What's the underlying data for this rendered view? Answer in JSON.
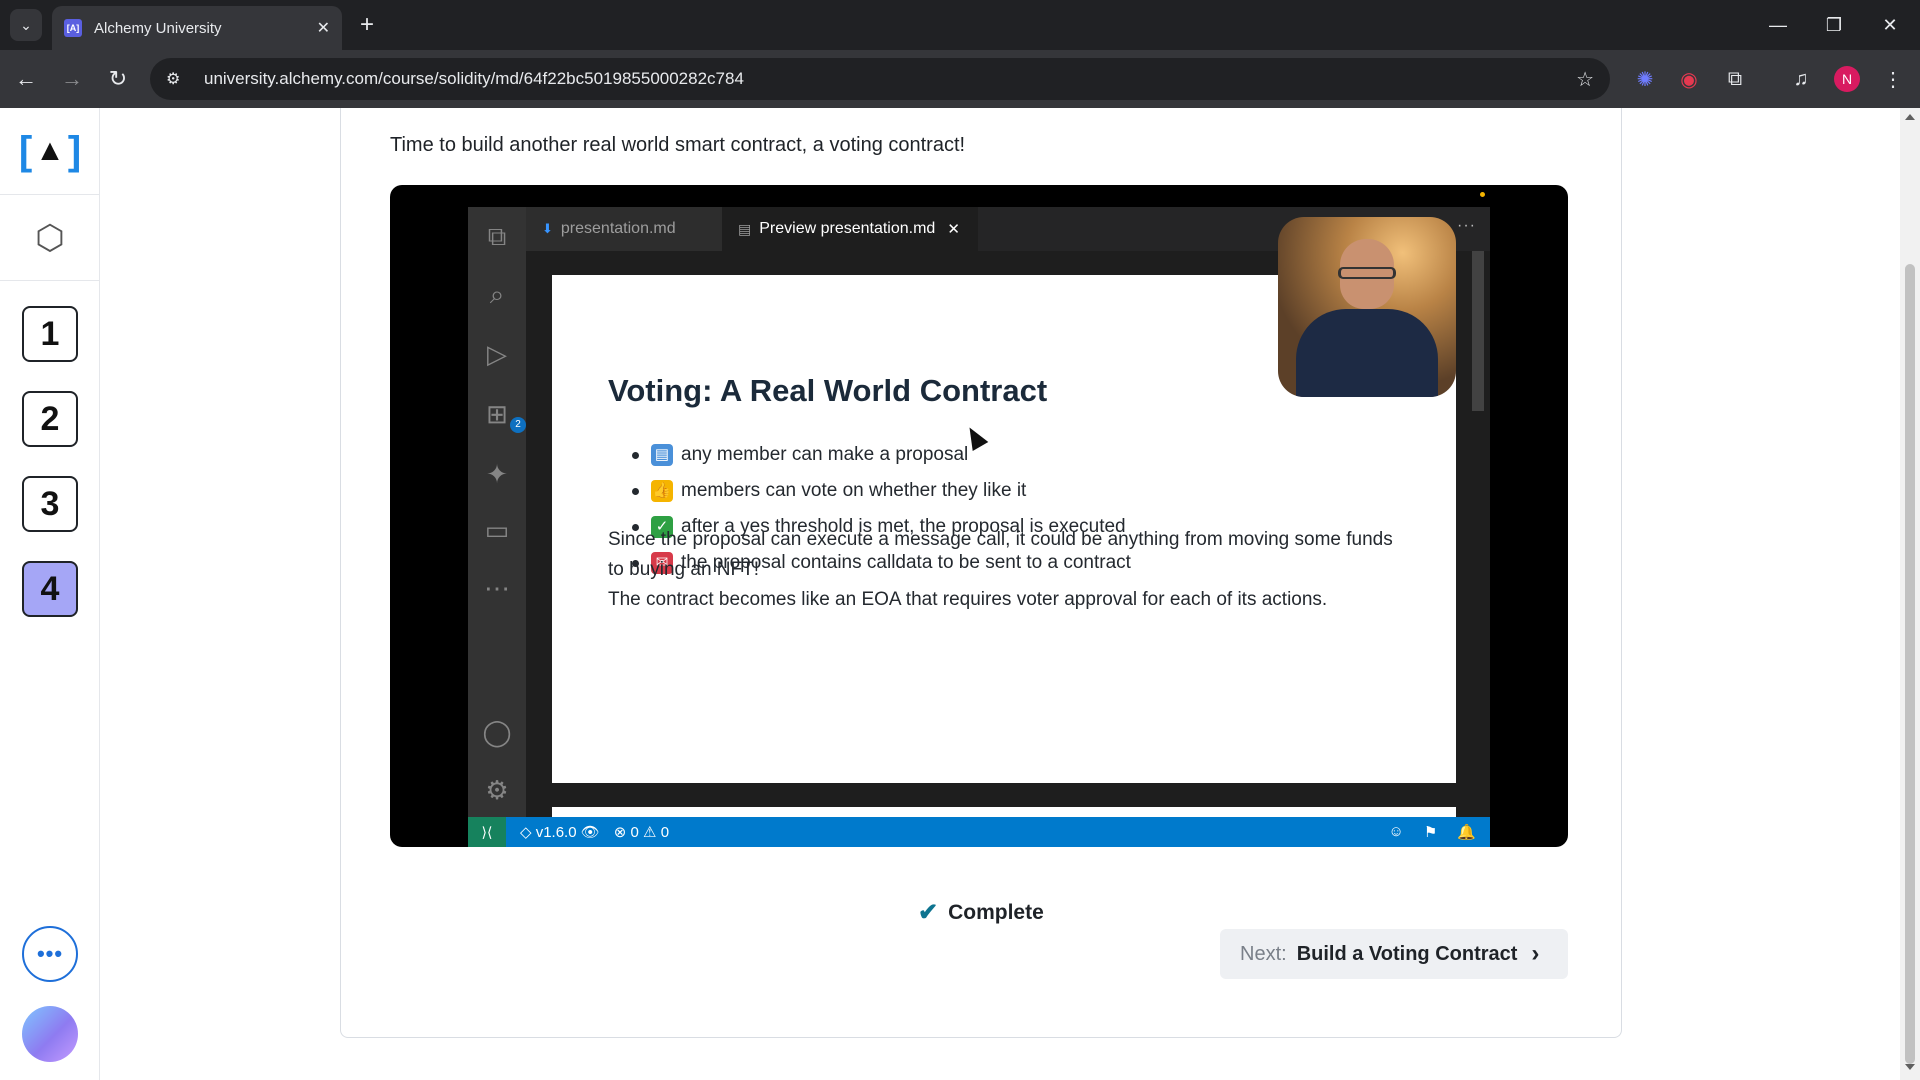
{
  "browser": {
    "tab_title": "Alchemy University",
    "favicon_text": "[A]",
    "url": "university.alchemy.com/course/solidity/md/64f22bc5019855000282c784",
    "profile_initial": "N"
  },
  "sidebar": {
    "modules": [
      {
        "label": "1",
        "active": false
      },
      {
        "label": "2",
        "active": false
      },
      {
        "label": "3",
        "active": false
      },
      {
        "label": "4",
        "active": true
      }
    ],
    "more_label": "•••",
    "active_color": "#a5a6f6"
  },
  "lesson": {
    "intro": "Time to build another real world smart contract, a voting contract!"
  },
  "video": {
    "editor_tabs": [
      "presentation.md",
      "Preview presentation.md"
    ],
    "extensions_badge": "2",
    "slide": {
      "title": "Voting: A Real World Contract",
      "bullets": [
        {
          "emoji": "inbox-tray-icon",
          "text": "any member can make a proposal",
          "color": "#4a90d9"
        },
        {
          "emoji": "thumbs-up-icon",
          "text": "members can vote on whether they like it",
          "color": "#f5b400"
        },
        {
          "emoji": "check-mark-button-icon",
          "text": "after a yes threshold is met, the proposal is executed",
          "color": "#2ea043"
        },
        {
          "emoji": "mailbox-icon",
          "text": "the proposal contains calldata to be sent to a contract",
          "color": "#d73a49"
        }
      ],
      "para1": "Since the proposal can execute a message call, it could be anything from moving some funds to buying an NFT!",
      "para2": "The contract becomes like an EOA that requires voter approval for each of its actions."
    },
    "statusbar": {
      "version": "v1.6.0",
      "errors": "0",
      "warnings": "0"
    }
  },
  "actions": {
    "complete_label": "Complete",
    "next_prefix": "Next:",
    "next_title": "Build a Voting Contract"
  }
}
